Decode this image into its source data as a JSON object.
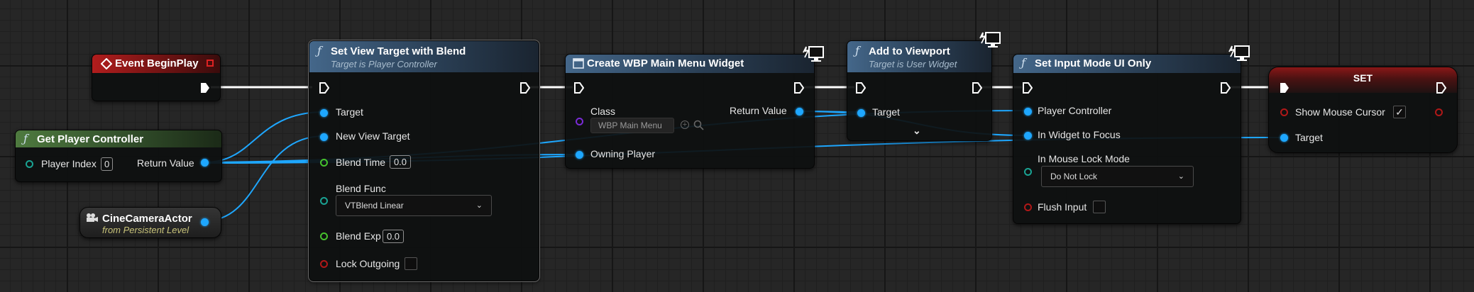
{
  "nodes": {
    "event_begin_play": {
      "title": "Event BeginPlay"
    },
    "get_player_controller": {
      "title": "Get Player Controller",
      "player_index_label": "Player Index",
      "player_index_value": "0",
      "return_value_label": "Return Value"
    },
    "cine_camera_actor": {
      "title": "CineCameraActor",
      "subtitle": "from Persistent Level"
    },
    "set_view_target": {
      "title": "Set View Target with Blend",
      "subtitle": "Target is Player Controller",
      "target_label": "Target",
      "new_view_target_label": "New View Target",
      "blend_time_label": "Blend Time",
      "blend_time_value": "0.0",
      "blend_func_label": "Blend Func",
      "blend_func_value": "VTBlend Linear",
      "blend_exp_label": "Blend Exp",
      "blend_exp_value": "0.0",
      "lock_outgoing_label": "Lock Outgoing"
    },
    "create_widget": {
      "title": "Create WBP Main Menu Widget",
      "class_label": "Class",
      "class_value": "WBP Main Menu",
      "return_value_label": "Return Value",
      "owning_player_label": "Owning Player"
    },
    "add_to_viewport": {
      "title": "Add to Viewport",
      "subtitle": "Target is User Widget",
      "target_label": "Target"
    },
    "set_input_mode": {
      "title": "Set Input Mode UI Only",
      "player_controller_label": "Player Controller",
      "widget_focus_label": "In Widget to Focus",
      "mouse_lock_label": "In Mouse Lock Mode",
      "mouse_lock_value": "Do Not Lock",
      "flush_input_label": "Flush Input"
    },
    "set_node": {
      "title": "SET",
      "show_cursor_label": "Show Mouse Cursor",
      "show_cursor_checked": "✓",
      "target_label": "Target"
    }
  },
  "colors": {
    "exec_wire": "#ffffff",
    "object_wire": "#1ea7ff",
    "function_header": "#44678a",
    "event_header": "#b11d1d",
    "pure_header": "#4e7a3f",
    "set_header": "#8a1717"
  },
  "icons": {
    "function": "f",
    "event": "event-diamond-icon",
    "camera": "camera-icon",
    "widget": "widget-icon",
    "client_only": "monitor-icon",
    "expand": "chevron-down-icon"
  }
}
